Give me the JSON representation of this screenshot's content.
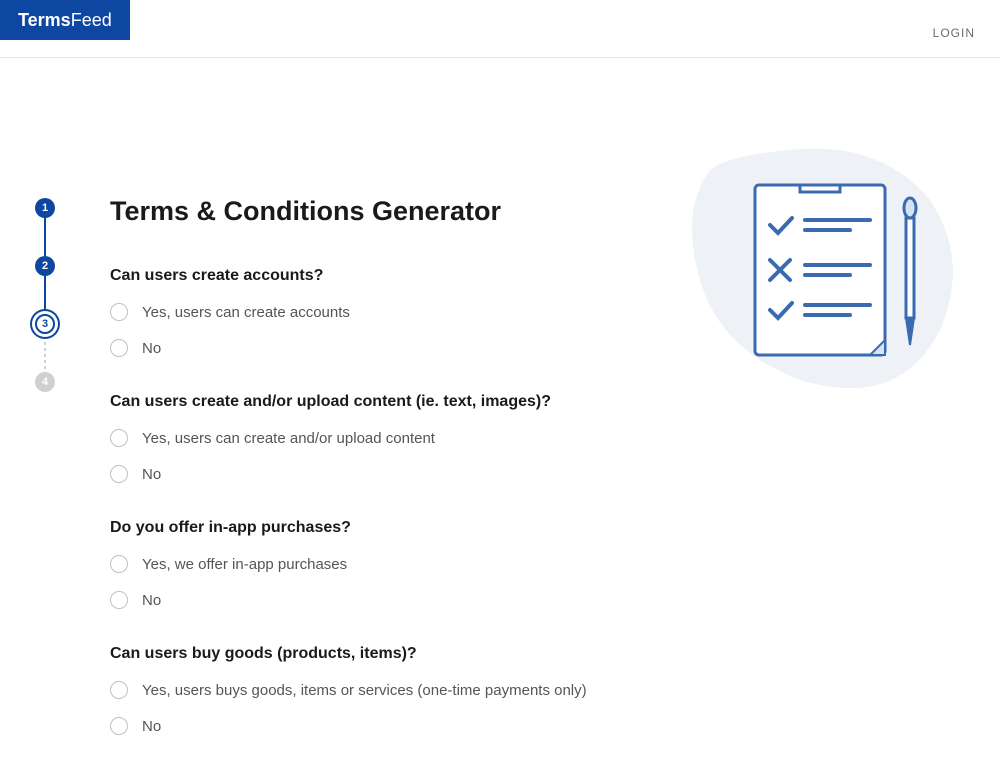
{
  "header": {
    "logo_terms": "Terms",
    "logo_feed": "Feed",
    "login": "LOGIN"
  },
  "stepper": {
    "steps": [
      "1",
      "2",
      "3",
      "4"
    ]
  },
  "page": {
    "title": "Terms & Conditions Generator"
  },
  "questions": [
    {
      "text": "Can users create accounts?",
      "options": [
        "Yes, users can create accounts",
        "No"
      ]
    },
    {
      "text": "Can users create and/or upload content (ie. text, images)?",
      "options": [
        "Yes, users can create and/or upload content",
        "No"
      ]
    },
    {
      "text": "Do you offer in-app purchases?",
      "options": [
        "Yes, we offer in-app purchases",
        "No"
      ]
    },
    {
      "text": "Can users buy goods (products, items)?",
      "options": [
        "Yes, users buys goods, items or services (one-time payments only)",
        "No"
      ]
    }
  ]
}
